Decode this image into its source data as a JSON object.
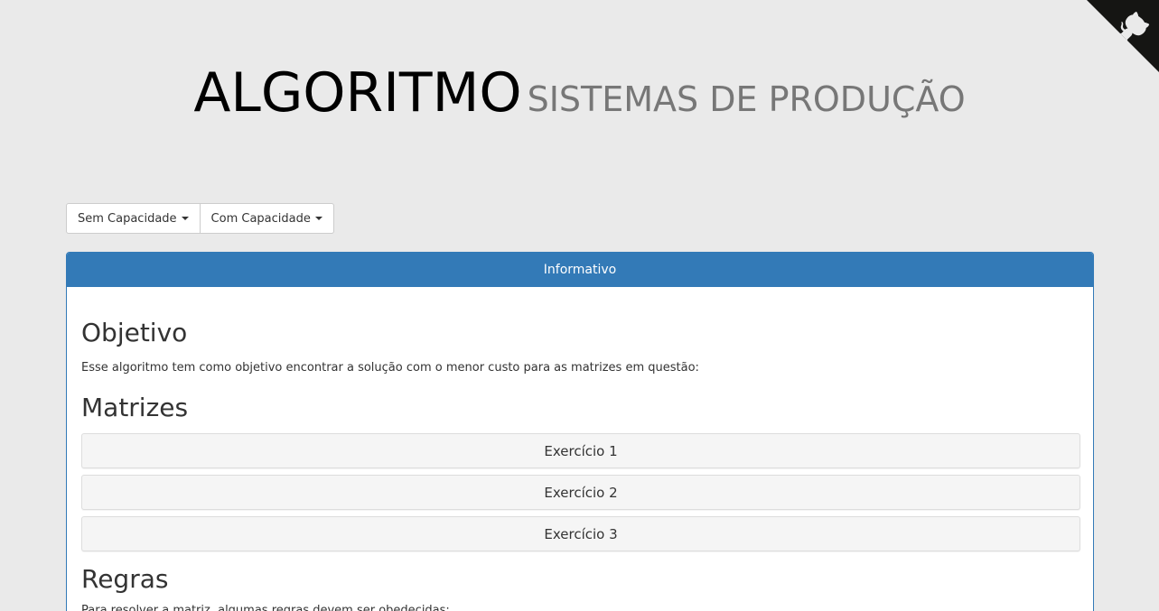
{
  "header": {
    "title": "ALGORITMO",
    "subtitle": "SISTEMAS DE PRODUÇÃO"
  },
  "menu": {
    "items": [
      {
        "label": "Sem Capacidade"
      },
      {
        "label": "Com Capacidade"
      }
    ]
  },
  "panel": {
    "heading": "Informativo",
    "objetivo": {
      "title": "Objetivo",
      "text": "Esse algoritmo tem como objetivo encontrar a solução com o menor custo para as matrizes em questão:"
    },
    "matrizes": {
      "title": "Matrizes",
      "items": [
        "Exercício 1",
        "Exercício 2",
        "Exercício 3"
      ]
    },
    "regras": {
      "title": "Regras",
      "text": "Para resolver a matriz, algumas regras devem ser obedecidas:"
    }
  },
  "colors": {
    "background": "#eaeaea",
    "panel_primary": "#337ab7",
    "corner": "#151513"
  },
  "icons": {
    "corner": "github-octocat-icon",
    "dropdown": "caret-down-icon"
  }
}
